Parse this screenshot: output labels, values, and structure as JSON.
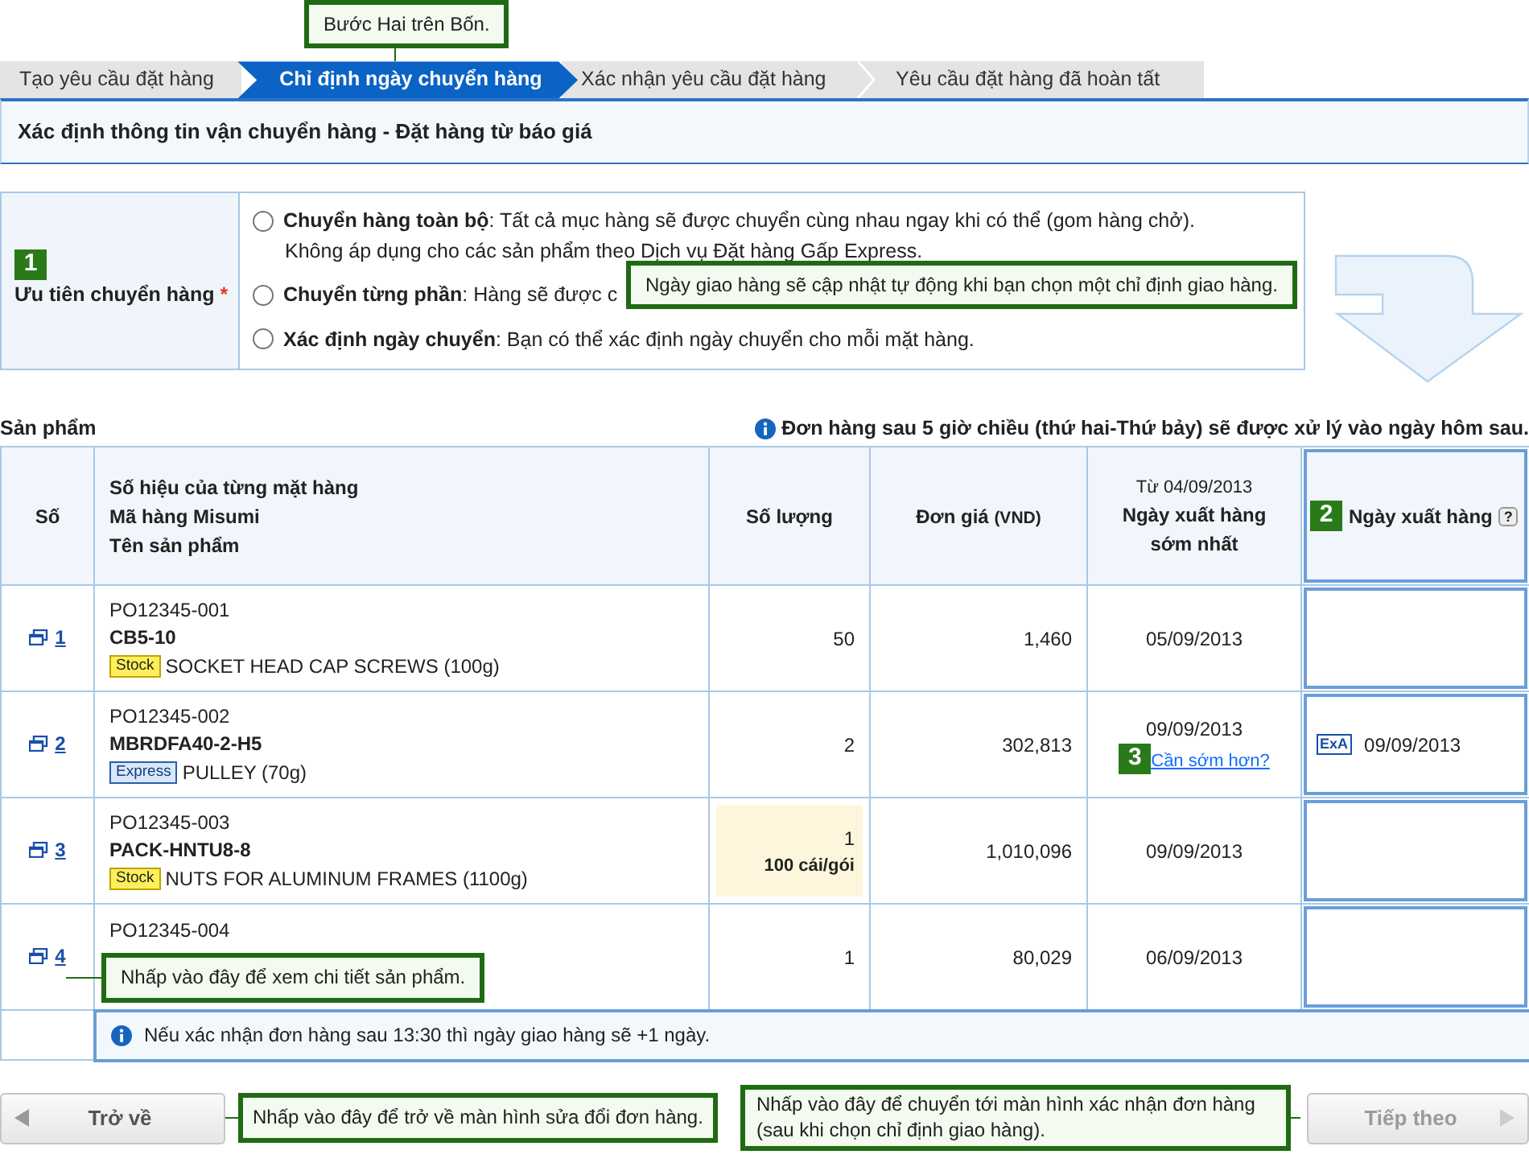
{
  "step_callout": "Bước Hai trên Bốn.",
  "steps": [
    {
      "label": "Tạo yêu cầu đặt hàng",
      "selected": false
    },
    {
      "label": "Chỉ định ngày chuyển hàng",
      "selected": true
    },
    {
      "label": "Xác nhận yêu cầu đặt hàng",
      "selected": false
    },
    {
      "label": "Yêu cầu đặt hàng đã hoàn tất",
      "selected": false
    }
  ],
  "panel_title": "Xác định thông tin vận chuyển hàng - Đặt hàng từ báo giá",
  "shipping_preference": {
    "badge": "1",
    "label": "Ưu tiên chuyển hàng",
    "required_mark": "*",
    "options": [
      {
        "name": "Chuyển hàng toàn bộ",
        "description": ": Tất cả mục hàng sẽ được chuyển cùng nhau ngay khi có thể (gom hàng chở).",
        "note": "Không áp dụng cho các sản phẩm theo Dịch vụ Đặt hàng Gấp Express.",
        "selected": false
      },
      {
        "name": "Chuyển từng phần",
        "description": ": Hàng sẽ được c",
        "selected": false
      },
      {
        "name": "Xác định ngày chuyển",
        "description": ": Bạn có thể xác định ngày chuyển cho mỗi mặt hàng.",
        "selected": false
      }
    ],
    "callout": "Ngày giao hàng sẽ cập nhật tự động khi bạn chọn một chỉ định giao hàng."
  },
  "products": {
    "title": "Sản phẩm",
    "notice": "Đơn hàng sau 5 giờ chiều (thứ hai-Thứ bảy) sẽ được xử lý vào ngày hôm sau.",
    "columns": {
      "no": "Số",
      "item": [
        "Số hiệu của từng mặt hàng",
        "Mã hàng Misumi",
        "Tên sản phẩm"
      ],
      "quantity": "Số lượng",
      "price": "Đơn giá",
      "price_unit": "(VND)",
      "earliest_from": "Từ 04/09/2013",
      "earliest": "Ngày xuất hàng sớm nhất",
      "ship_badge": "2",
      "ship_date": "Ngày xuất hàng",
      "ship_help": "?"
    },
    "rows": [
      {
        "no": "1",
        "po": "PO12345-001",
        "code": "CB5-10",
        "tag": {
          "label": "Stock",
          "kind": "stock"
        },
        "name": "SOCKET HEAD CAP SCREWS (100g)",
        "quantity": "50",
        "price": "1,460",
        "earliest": "05/09/2013"
      },
      {
        "no": "2",
        "po": "PO12345-002",
        "code": "MBRDFA40-2-H5",
        "tag": {
          "label": "Express",
          "kind": "express"
        },
        "name": "PULLEY (70g)",
        "quantity": "2",
        "price": "302,813",
        "earliest": "09/09/2013",
        "badge": "3",
        "link": "Cần sớm hơn?",
        "ship_mode": "ExA",
        "ship_date": "09/09/2013"
      },
      {
        "no": "3",
        "po": "PO12345-003",
        "code": "PACK-HNTU8-8",
        "tag": {
          "label": "Stock",
          "kind": "stock"
        },
        "name": "NUTS FOR ALUMINUM FRAMES (1100g)",
        "quantity": "1",
        "pack": "100 cái/gói",
        "price": "1,010,096",
        "earliest": "09/09/2013"
      },
      {
        "no": "4",
        "po": "PO12345-004",
        "quantity": "1",
        "price": "80,029",
        "earliest": "06/09/2013",
        "callout": "Nhấp vào đây để xem chi tiết sản phẩm."
      }
    ],
    "footnote": "Nếu xác nhận đơn hàng sau 13:30 thì ngày giao hàng sẽ +1 ngày."
  },
  "back_button": {
    "label": "Trở về",
    "callout": "Nhấp vào đây để trở về màn hình sửa đổi đơn hàng."
  },
  "next_button": {
    "label": "Tiếp theo",
    "disabled": true,
    "callout": "Nhấp vào đây để chuyển tới màn hình xác nhận đơn hàng (sau khi chọn chỉ định giao hàng)."
  }
}
